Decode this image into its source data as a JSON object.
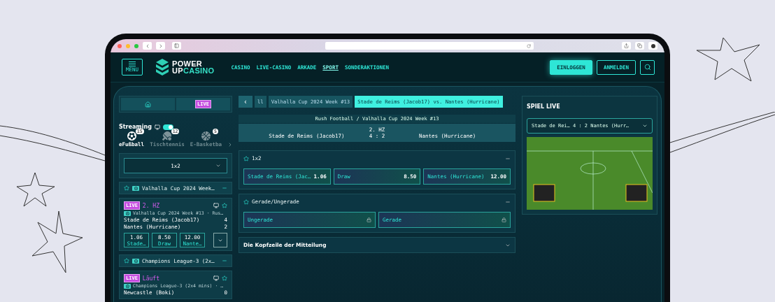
{
  "header": {
    "menu_label": "MENU",
    "logo": {
      "top": "POWER",
      "bottom_a": "UP",
      "bottom_b": "CASINO"
    },
    "nav": [
      {
        "label": "CASINO",
        "selected": false
      },
      {
        "label": "LIVE-CASINO",
        "selected": false
      },
      {
        "label": "ARKADE",
        "selected": false
      },
      {
        "label": "SPORT",
        "selected": true
      },
      {
        "label": "SONDERAKTIONEN",
        "selected": false
      }
    ],
    "buttons": [
      {
        "label": "EINLOGGEN",
        "kind": "primary"
      },
      {
        "label": "ANMELDEN",
        "kind": "outline"
      }
    ]
  },
  "sidebar": {
    "tabs": [
      {
        "kind": "home"
      },
      {
        "kind": "live",
        "label": "LIVE"
      }
    ],
    "streaming": {
      "label": "Streaming",
      "on": true
    },
    "sports": [
      {
        "kind": "football",
        "name": "eFußball",
        "count": "15",
        "selected": true
      },
      {
        "kind": "tennis",
        "name": "Tischtennis",
        "count": "12",
        "selected": false
      },
      {
        "kind": "basketball",
        "name": "E-Basketba",
        "count": "5",
        "selected": false
      }
    ],
    "market_select": "1x2",
    "groups": [
      {
        "title": "Valhalla Cup 2024 Week…",
        "expanded": true,
        "events": [
          {
            "badge": "LIVE",
            "period": "2. HZ",
            "league": "Valhalla Cup 2024 Week #13 · Rus…",
            "teams": [
              {
                "name": "Stade de Reims (Jacob17)",
                "score": "4"
              },
              {
                "name": "Nantes (Hurricane)",
                "score": "2"
              }
            ],
            "odds": [
              {
                "value": "1.06",
                "label": "Stade…"
              },
              {
                "value": "8.50",
                "label": "Draw"
              },
              {
                "value": "12.00",
                "label": "Nante…"
              }
            ]
          }
        ]
      },
      {
        "title": "Champions League-3 (2x…",
        "expanded": true,
        "events": [
          {
            "badge": "LIVE",
            "period": "Läuft",
            "league": "Champions League-3 (2x4 mins) · …",
            "teams": [
              {
                "name": "Newcastle (Boki)",
                "score": "0"
              }
            ]
          }
        ]
      }
    ]
  },
  "center": {
    "breadcrumbs": [
      {
        "kind": "back",
        "label": "‹",
        "selected": false
      },
      {
        "kind": "crumb",
        "label": "ll",
        "selected": false
      },
      {
        "kind": "crumb",
        "label": "Valhalla Cup 2024 Week #13",
        "selected": false
      },
      {
        "kind": "crumb",
        "label": "Stade de Reims (Jacob17) vs. Nantes (Hurricane)",
        "selected": true
      }
    ],
    "scoreboard": {
      "path": "Rush Football / Valhalla Cup 2024 Week #13",
      "home": "Stade de Reims (Jacob17)",
      "period": "2. HZ",
      "score": "4 : 2",
      "away": "Nantes (Hurricane)"
    },
    "markets": [
      {
        "kind": "market",
        "title": "1x2",
        "expanded": true,
        "outcomes": [
          {
            "label": "Stade de Reims (Jac…",
            "odds": "1.06",
            "locked": false
          },
          {
            "label": "Draw",
            "odds": "8.50",
            "locked": false
          },
          {
            "label": "Nantes (Hurricane)",
            "odds": "12.00",
            "locked": false
          }
        ]
      },
      {
        "kind": "market",
        "title": "Gerade/Ungerade",
        "expanded": true,
        "outcomes": [
          {
            "label": "Ungerade",
            "locked": true
          },
          {
            "label": "Gerade",
            "locked": true
          }
        ]
      },
      {
        "kind": "notice",
        "title": "Die Kopfzeile der Mitteilung",
        "expanded": false
      }
    ]
  },
  "live": {
    "title": "SPIEL LIVE",
    "select": "Stade de Rei… 4 : 2 Nantes (Hurr…"
  }
}
